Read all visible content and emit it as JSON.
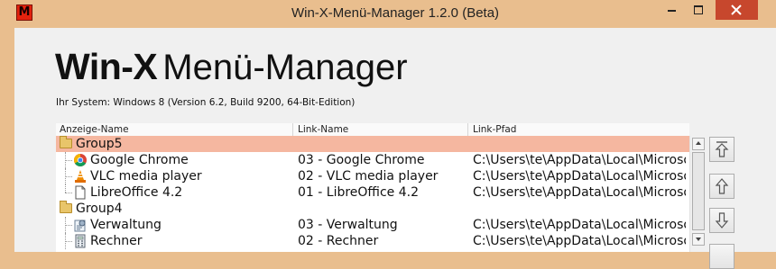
{
  "window": {
    "title": "Win-X-Menü-Manager 1.2.0 (Beta)",
    "app_icon_letter": "M",
    "close_color": "#c7472d",
    "frame_color": "#e9be8e"
  },
  "brand": {
    "bold": "Win-X",
    "light": "Menü-Manager"
  },
  "system_info": "Ihr System: Windows 8 (Version 6.2, Build 9200, 64-Bit-Edition)",
  "table": {
    "columns": [
      "Anzeige-Name",
      "Link-Name",
      "Link-Pfad"
    ],
    "rows": [
      {
        "type": "group",
        "label": "Group5",
        "selected": true
      },
      {
        "type": "item",
        "icon": "chrome-icon",
        "name": "Google Chrome",
        "link_name": "03 - Google Chrome",
        "link_path": "C:\\Users\\te\\AppData\\Local\\Microsoft"
      },
      {
        "type": "item",
        "icon": "vlc-cone-icon",
        "name": "VLC media player",
        "link_name": "02 - VLC media player",
        "link_path": "C:\\Users\\te\\AppData\\Local\\Microsoft"
      },
      {
        "type": "item",
        "icon": "document-icon",
        "name": "LibreOffice 4.2",
        "link_name": "01 - LibreOffice 4.2",
        "link_path": "C:\\Users\\te\\AppData\\Local\\Microsoft"
      },
      {
        "type": "group",
        "label": "Group4",
        "selected": false
      },
      {
        "type": "item",
        "icon": "admin-tools-icon",
        "name": "Verwaltung",
        "link_name": "03 - Verwaltung",
        "link_path": "C:\\Users\\te\\AppData\\Local\\Microsoft"
      },
      {
        "type": "item",
        "icon": "calculator-icon",
        "name": "Rechner",
        "link_name": "02 - Rechner",
        "link_path": "C:\\Users\\te\\AppData\\Local\\Microsoft"
      }
    ]
  },
  "side_buttons": [
    "move-to-top-icon",
    "move-up-icon",
    "move-down-icon"
  ],
  "selection_color": "#f5b7a0"
}
